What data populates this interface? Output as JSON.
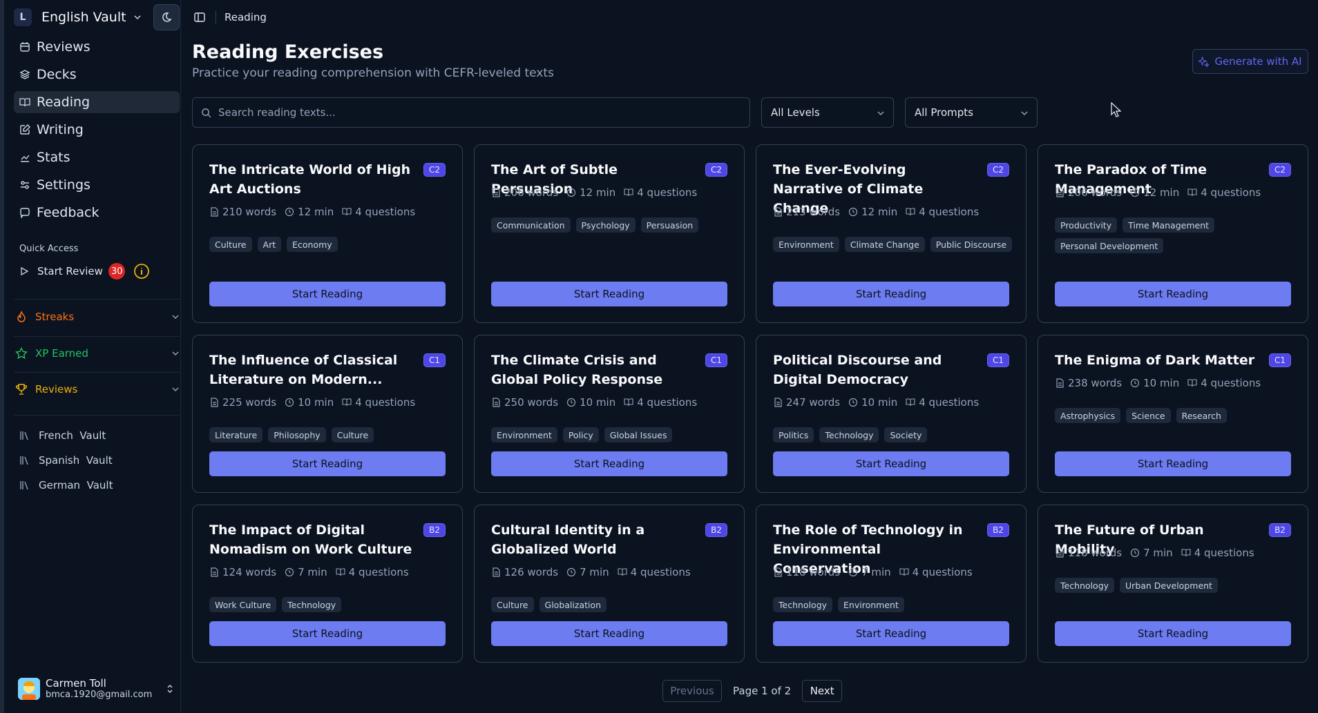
{
  "sidebar": {
    "vault_initial": "L",
    "vault_name": "English Vault",
    "nav": [
      {
        "label": "Reviews",
        "icon": "calendar-icon"
      },
      {
        "label": "Decks",
        "icon": "layers-icon"
      },
      {
        "label": "Reading",
        "icon": "book-open-icon",
        "active": true
      },
      {
        "label": "Writing",
        "icon": "pen-square-icon"
      },
      {
        "label": "Stats",
        "icon": "chart-icon"
      },
      {
        "label": "Settings",
        "icon": "sliders-icon"
      },
      {
        "label": "Feedback",
        "icon": "message-icon"
      }
    ],
    "quick_access_title": "Quick Access",
    "start_review_label": "Start Review",
    "start_review_count": "30",
    "streaks_label": "Streaks",
    "xp_label": "XP Earned",
    "reviews_label": "Reviews",
    "vaults": [
      "French  Vault",
      "Spanish  Vault",
      "German  Vault"
    ],
    "user_name": "Carmen Toll",
    "user_email": "bmca.1920@gmail.com"
  },
  "topbar": {
    "breadcrumb": "Reading"
  },
  "header": {
    "title": "Reading Exercises",
    "subtitle": "Practice your reading comprehension with CEFR-leveled texts",
    "generate_label": "Generate with AI"
  },
  "filters": {
    "search_placeholder": "Search reading texts...",
    "level_value": "All Levels",
    "prompt_value": "All Prompts"
  },
  "cards": [
    {
      "title": "The Intricate World of High Art Auctions",
      "level": "C2",
      "words": "210 words",
      "time": "12 min",
      "questions": "4 questions",
      "tags": [
        "Culture",
        "Art",
        "Economy"
      ]
    },
    {
      "title": "The Art of Subtle Persuasion",
      "level": "C2",
      "words": "206 words",
      "time": "12 min",
      "questions": "4 questions",
      "tags": [
        "Communication",
        "Psychology",
        "Persuasion"
      ]
    },
    {
      "title": "The Ever-Evolving Narrative of Climate Change",
      "level": "C2",
      "words": "213 words",
      "time": "12 min",
      "questions": "4 questions",
      "tags": [
        "Environment",
        "Climate Change",
        "Public Discourse"
      ]
    },
    {
      "title": "The Paradox of Time Management",
      "level": "C2",
      "words": "206 words",
      "time": "12 min",
      "questions": "4 questions",
      "tags": [
        "Productivity",
        "Time Management",
        "Personal Development"
      ]
    },
    {
      "title": "The Influence of Classical Literature on Modern...",
      "level": "C1",
      "words": "225 words",
      "time": "10 min",
      "questions": "4 questions",
      "tags": [
        "Literature",
        "Philosophy",
        "Culture"
      ]
    },
    {
      "title": "The Climate Crisis and Global Policy Response",
      "level": "C1",
      "words": "250 words",
      "time": "10 min",
      "questions": "4 questions",
      "tags": [
        "Environment",
        "Policy",
        "Global Issues"
      ]
    },
    {
      "title": "Political Discourse and Digital Democracy",
      "level": "C1",
      "words": "247 words",
      "time": "10 min",
      "questions": "4 questions",
      "tags": [
        "Politics",
        "Technology",
        "Society"
      ]
    },
    {
      "title": "The Enigma of Dark Matter",
      "level": "C1",
      "words": "238 words",
      "time": "10 min",
      "questions": "4 questions",
      "tags": [
        "Astrophysics",
        "Science",
        "Research"
      ]
    },
    {
      "title": "The Impact of Digital Nomadism on Work Culture",
      "level": "B2",
      "words": "124 words",
      "time": "7 min",
      "questions": "4 questions",
      "tags": [
        "Work Culture",
        "Technology"
      ]
    },
    {
      "title": "Cultural Identity in a Globalized World",
      "level": "B2",
      "words": "126 words",
      "time": "7 min",
      "questions": "4 questions",
      "tags": [
        "Culture",
        "Globalization"
      ]
    },
    {
      "title": "The Role of Technology in Environmental Conservation",
      "level": "B2",
      "words": "118 words",
      "time": "7 min",
      "questions": "4 questions",
      "tags": [
        "Technology",
        "Environment"
      ]
    },
    {
      "title": "The Future of Urban Mobility",
      "level": "B2",
      "words": "118 words",
      "time": "7 min",
      "questions": "4 questions",
      "tags": [
        "Technology",
        "Urban Development"
      ]
    }
  ],
  "start_label": "Start Reading",
  "pagination": {
    "previous": "Previous",
    "page_info": "Page 1 of 2",
    "next": "Next"
  }
}
